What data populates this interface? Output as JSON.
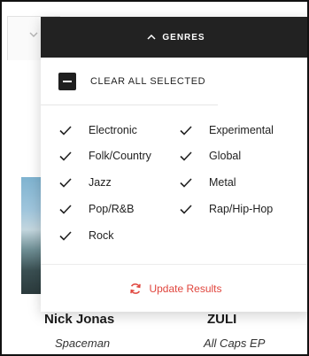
{
  "dropdown": {
    "header_label": "GENRES",
    "clear_label": "CLEAR ALL SELECTED",
    "genres": [
      {
        "label": "Electronic",
        "checked": true
      },
      {
        "label": "Experimental",
        "checked": true
      },
      {
        "label": "Folk/Country",
        "checked": true
      },
      {
        "label": "Global",
        "checked": true
      },
      {
        "label": "Jazz",
        "checked": true
      },
      {
        "label": "Metal",
        "checked": true
      },
      {
        "label": "Pop/R&B",
        "checked": true
      },
      {
        "label": "Rap/Hip-Hop",
        "checked": true
      },
      {
        "label": "Rock",
        "checked": true
      }
    ],
    "update_label": "Update Results"
  },
  "results": [
    {
      "artist": "Nick Jonas",
      "album": "Spaceman"
    },
    {
      "artist": "ZULI",
      "album": "All Caps EP"
    }
  ],
  "icons": {
    "header": "chevron-up-icon",
    "clear": "minus-box-icon",
    "genre": "checkmark-icon",
    "update": "refresh-icon",
    "background_select": "chevron-down-icon"
  },
  "colors": {
    "header_bg": "#222222",
    "accent_red": "#e0453d"
  }
}
